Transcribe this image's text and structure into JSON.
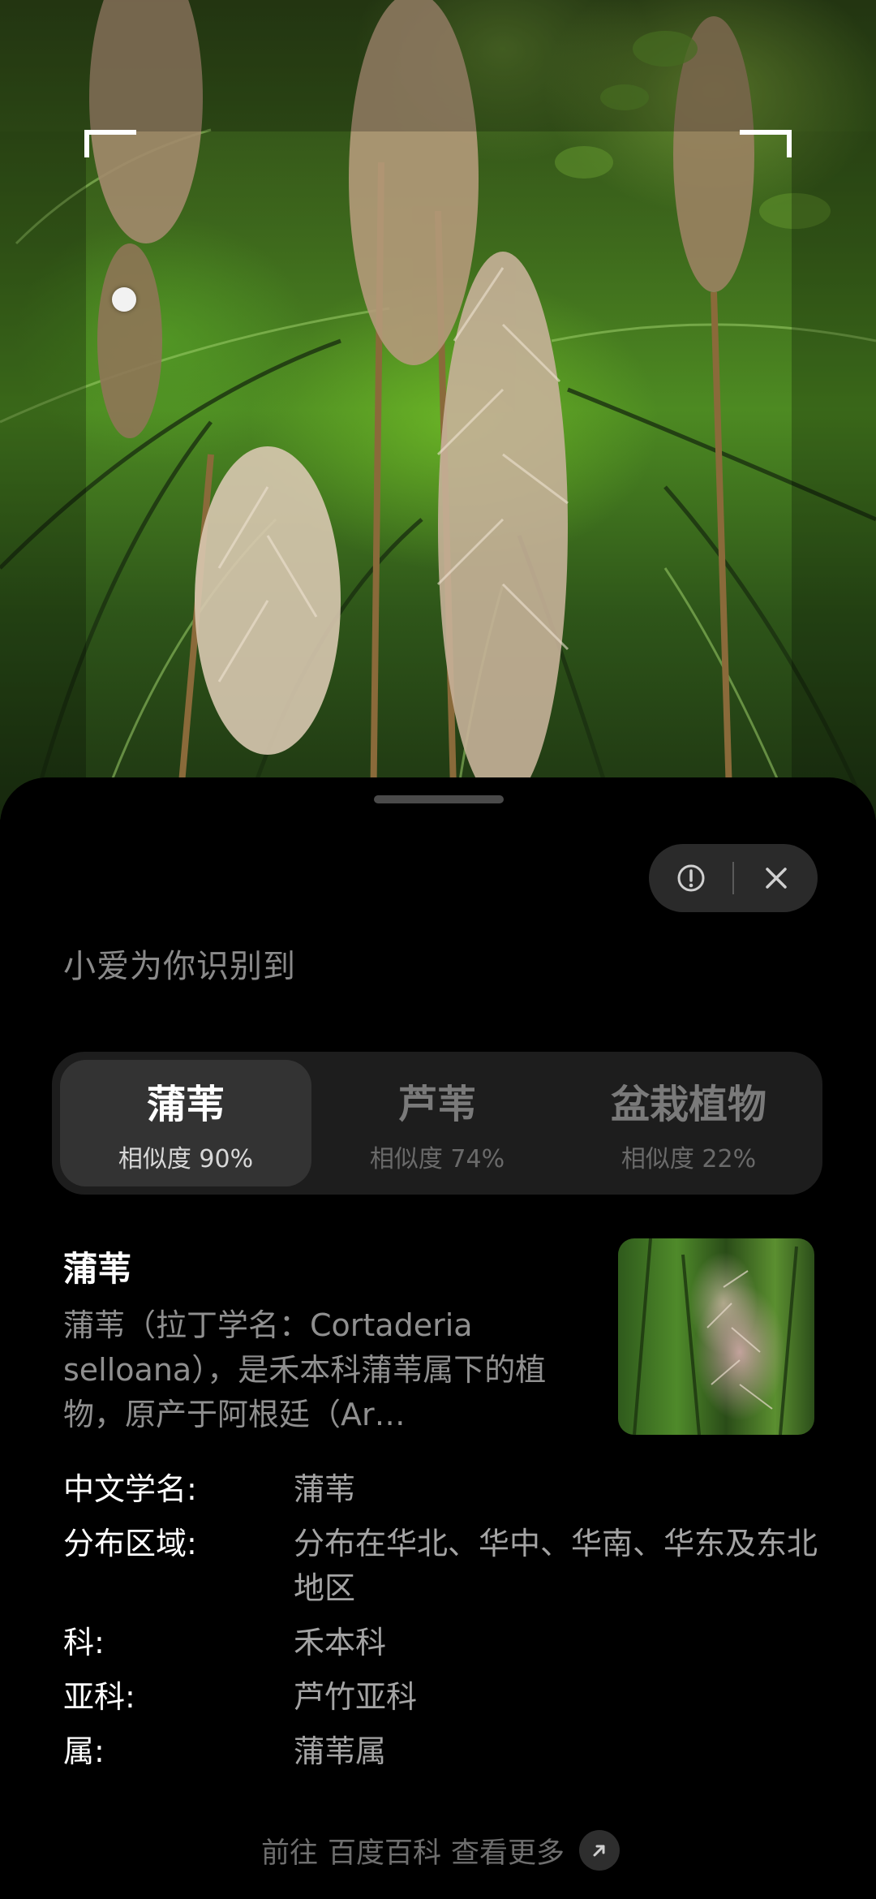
{
  "camera": {
    "scene": "plant-photo"
  },
  "actions": {
    "feedback_icon": "alert-circle-icon",
    "close_icon": "close-icon"
  },
  "subtitle": "小爱为你识别到",
  "candidates": [
    {
      "name": "蒲苇",
      "similarity": "相似度 90%",
      "active": true
    },
    {
      "name": "芦苇",
      "similarity": "相似度 74%",
      "active": false
    },
    {
      "name": "盆栽植物",
      "similarity": "相似度 22%",
      "active": false
    }
  ],
  "result": {
    "title": "蒲苇",
    "description": "蒲苇（拉丁学名：Cortaderia selloana），是禾本科蒲苇属下的植物，原产于阿根廷（Ar…",
    "thumbnail_icon": "plant-thumbnail-image"
  },
  "info": [
    {
      "label": "中文学名:",
      "value": "蒲苇"
    },
    {
      "label": "分布区域:",
      "value": "分布在华北、华中、华南、华东及东北地区"
    },
    {
      "label": "科:",
      "value": "禾本科"
    },
    {
      "label": "亚科:",
      "value": "芦竹亚科"
    },
    {
      "label": "属:",
      "value": "蒲苇属"
    }
  ],
  "more": {
    "prefix": "前往",
    "source": "百度百科",
    "suffix": "查看更多",
    "icon": "arrow-up-right-icon"
  }
}
